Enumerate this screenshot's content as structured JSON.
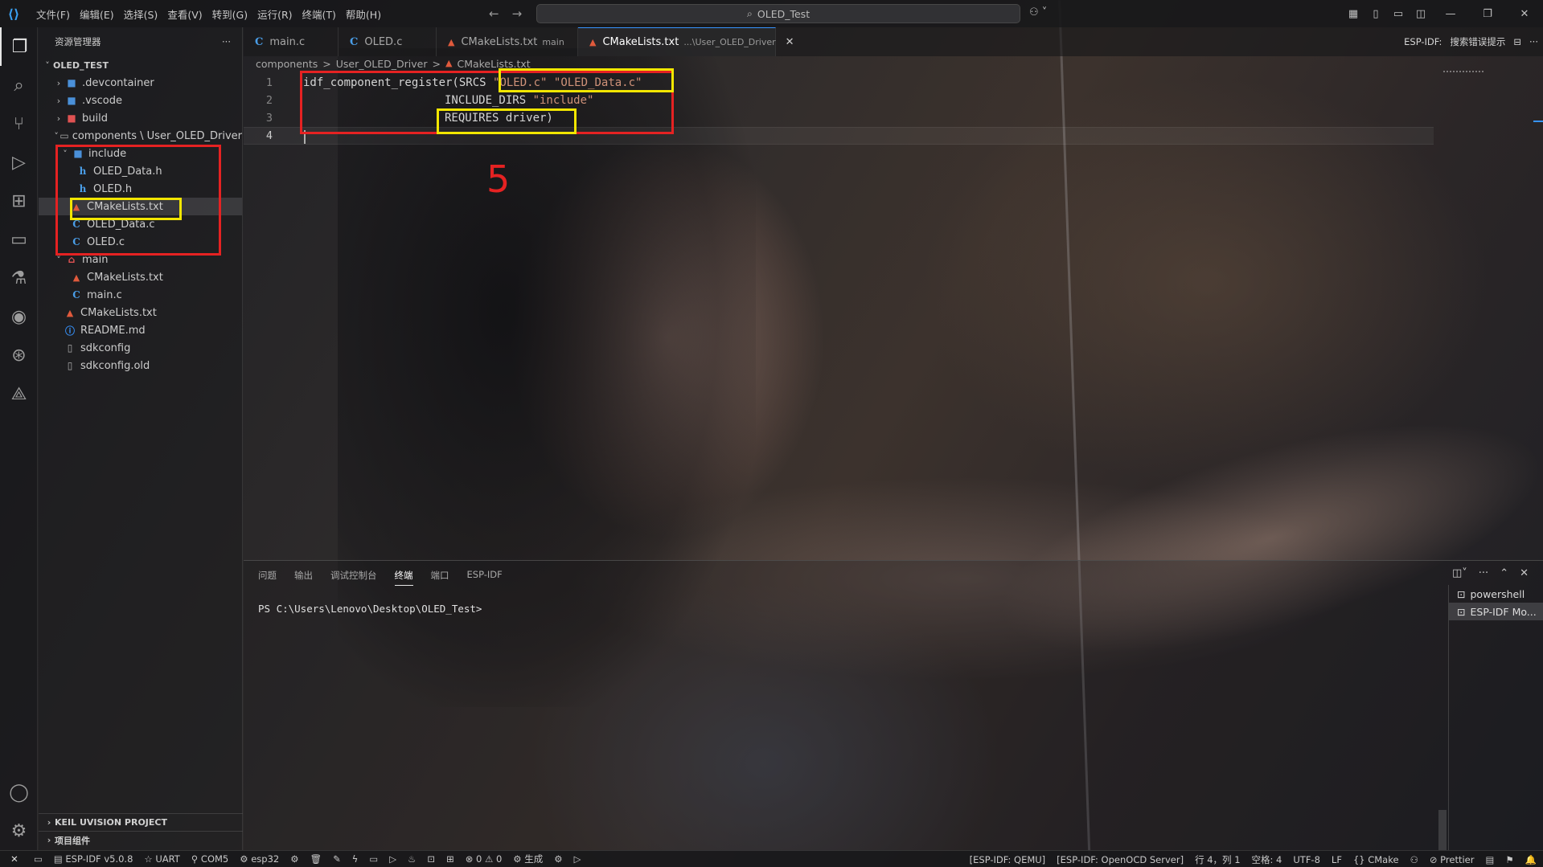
{
  "window": {
    "menu": [
      "文件(F)",
      "编辑(E)",
      "选择(S)",
      "查看(V)",
      "转到(G)",
      "运行(R)",
      "终端(T)",
      "帮助(H)"
    ],
    "search_text": "OLED_Test"
  },
  "sidebar": {
    "title": "资源管理器",
    "more": "···",
    "root": "OLED_TEST",
    "items": [
      {
        "label": ".devcontainer",
        "icon": "folder-icon"
      },
      {
        "label": ".vscode",
        "icon": "folder-icon"
      },
      {
        "label": "build",
        "icon": "folder-icon"
      },
      {
        "label": "components \\ User_OLED_Driver",
        "icon": "folder-open-icon"
      },
      {
        "label": "include",
        "icon": "folder-icon"
      },
      {
        "label": "OLED_Data.h",
        "icon": "h-file-icon"
      },
      {
        "label": "OLED.h",
        "icon": "h-file-icon"
      },
      {
        "label": "CMakeLists.txt",
        "icon": "cmake-icon"
      },
      {
        "label": "OLED_Data.c",
        "icon": "c-file-icon"
      },
      {
        "label": "OLED.c",
        "icon": "c-file-icon"
      },
      {
        "label": "main",
        "icon": "folder-icon"
      },
      {
        "label": "CMakeLists.txt",
        "icon": "cmake-icon"
      },
      {
        "label": "main.c",
        "icon": "c-file-icon"
      },
      {
        "label": "CMakeLists.txt",
        "icon": "cmake-icon"
      },
      {
        "label": "README.md",
        "icon": "info-icon"
      },
      {
        "label": "sdkconfig",
        "icon": "file-icon"
      },
      {
        "label": "sdkconfig.old",
        "icon": "file-icon"
      }
    ],
    "sections": [
      "KEIL UVISION PROJECT",
      "项目组件"
    ]
  },
  "tabs": [
    {
      "label": "main.c",
      "icon": "C",
      "desc": ""
    },
    {
      "label": "OLED.c",
      "icon": "C",
      "desc": ""
    },
    {
      "label": "CMakeLists.txt",
      "icon": "▲",
      "desc": "main"
    },
    {
      "label": "CMakeLists.txt",
      "icon": "▲",
      "desc": "...\\User_OLED_Driver"
    }
  ],
  "tabs_right": {
    "label": "ESP-IDF:",
    "value": "搜索错误提示"
  },
  "breadcrumb": [
    "components",
    ">",
    "User_OLED_Driver",
    ">",
    "CMakeLists.txt"
  ],
  "editor": {
    "line_numbers": [
      "1",
      "2",
      "3",
      "4"
    ],
    "line1_a": "idf_component_register(SRCS ",
    "line1_s1": "\"OLED.c\"",
    "line1_s2": "\"OLED_Data.c\"",
    "line2_a": "INCLUDE_DIRS ",
    "line2_s": "\"include\"",
    "line3": "REQUIRES driver)",
    "step_number": "5"
  },
  "panel": {
    "tabs": [
      "问题",
      "输出",
      "调试控制台",
      "终端",
      "端口",
      "ESP-IDF"
    ],
    "active_tab": "终端",
    "prompt": "PS C:\\Users\\Lenovo\\Desktop\\OLED_Test>",
    "terminals": [
      "powershell",
      "ESP-IDF Mo..."
    ]
  },
  "statusbar": {
    "left": [
      "ESP-IDF v5.0.8",
      "UART",
      "COM5",
      "esp32",
      "0",
      "0",
      "生成"
    ],
    "right": [
      "[ESP-IDF: QEMU]",
      "[ESP-IDF: OpenOCD Server]",
      "行 4，列 1",
      "空格: 4",
      "UTF-8",
      "LF",
      "CMake",
      "Prettier"
    ]
  },
  "colors": {
    "accent": "#3794ff",
    "annotation_red": "#e52222",
    "annotation_yellow": "#f2e600"
  }
}
